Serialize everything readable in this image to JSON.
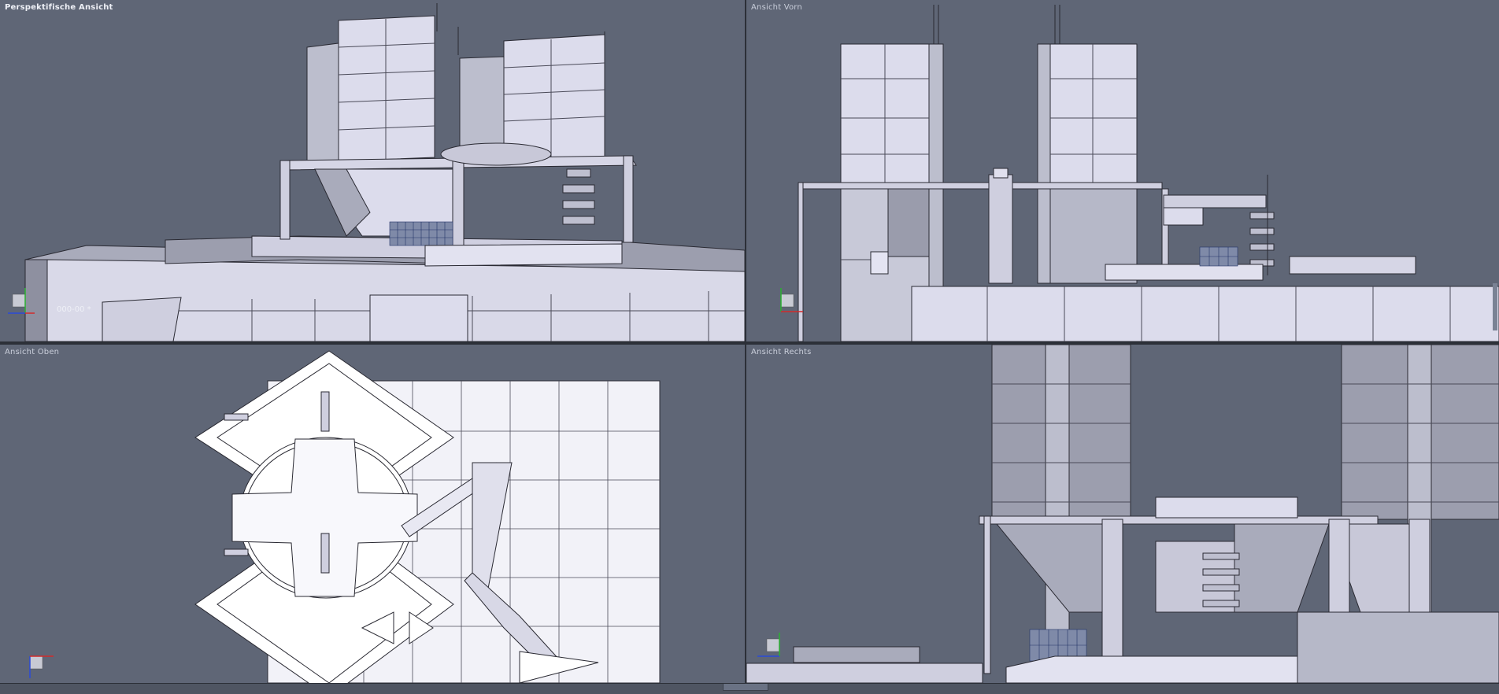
{
  "viewports": {
    "perspective": {
      "label": "Perspektifische Ansicht",
      "object_label": "000-00 *"
    },
    "front": {
      "label": "Ansicht Vorn"
    },
    "top": {
      "label": "Ansicht Oben"
    },
    "right": {
      "label": "Ansicht Rechts"
    }
  },
  "axes": {
    "x": "X",
    "y": "Y",
    "z": "Z"
  },
  "colors": {
    "background": "#5f6676",
    "mesh_fill": "#dcdcec",
    "mesh_shade": "#a9abbb",
    "mesh_line": "#2a2a33",
    "axis_x": "#d22a2a",
    "axis_y": "#2ab030",
    "axis_z": "#2a4ad8"
  }
}
